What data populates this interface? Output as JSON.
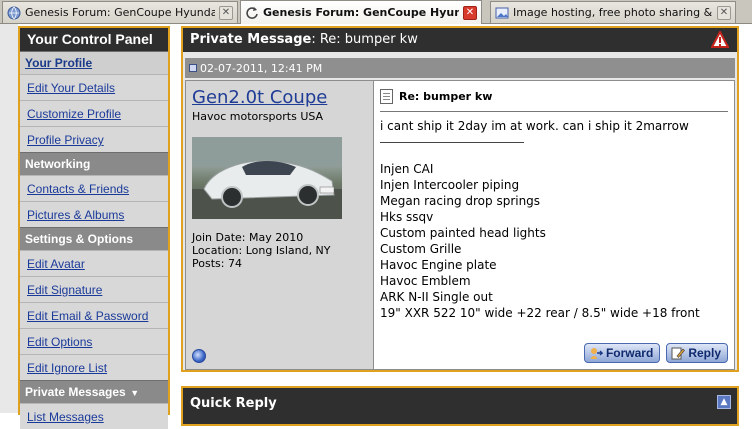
{
  "browser": {
    "tabs": [
      {
        "title": "Genesis Forum: GenCoupe Hyundai Ge...",
        "active": false
      },
      {
        "title": "Genesis Forum: GenCoupe Hyund...",
        "active": true
      },
      {
        "title": "Image hosting, free photo sharing & vi...",
        "active": false
      }
    ]
  },
  "sidebar": {
    "title": "Your Control Panel",
    "sections": [
      {
        "heading": "Your Profile",
        "items": [
          "Edit Your Details",
          "Customize Profile",
          "Profile Privacy"
        ]
      },
      {
        "heading": "Networking",
        "items": [
          "Contacts & Friends",
          "Pictures & Albums"
        ]
      },
      {
        "heading": "Settings & Options",
        "items": [
          "Edit Avatar",
          "Edit Signature",
          "Edit Email & Password",
          "Edit Options",
          "Edit Ignore List"
        ]
      },
      {
        "heading": "Private Messages",
        "items": [
          "List Messages"
        ]
      }
    ]
  },
  "pm": {
    "header_label": "Private Message",
    "header_subject": ": Re: bumper kw",
    "date": "02-07-2011, 12:41 PM",
    "user": {
      "name": "Gen2.0t  Coupe",
      "title": "Havoc motorsports USA",
      "join_date": "Join Date: May 2010",
      "location": "Location: Long Island, NY",
      "posts": "Posts: 74"
    },
    "subject": "Re: bumper kw",
    "intro": "i cant ship it 2day im at work. can i ship it 2marrow",
    "parts": [
      "Injen CAI",
      "Injen Intercooler piping",
      "Megan racing drop springs",
      "Hks ssqv",
      "Custom painted head lights",
      "Custom Grille",
      "Havoc Engine plate",
      "Havoc Emblem",
      "ARK N-II Single out",
      "19\" XXR 522 10\" wide +22 rear / 8.5\" wide +18 front"
    ],
    "buttons": {
      "forward": "Forward",
      "reply": "Reply"
    }
  },
  "quick_reply": {
    "title": "Quick Reply"
  }
}
